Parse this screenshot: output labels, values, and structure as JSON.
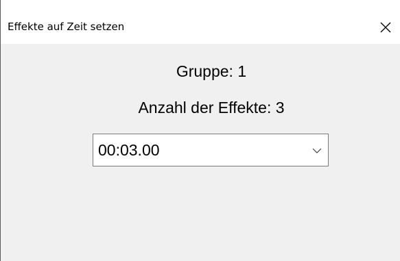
{
  "window": {
    "title": "Effekte auf Zeit setzen",
    "close_icon": "close-icon"
  },
  "content": {
    "group_label": "Gruppe: 1",
    "effect_count_label": "Anzahl der Effekte: 3",
    "time_select": {
      "value": "00:03.00",
      "arrow_icon": "chevron-down-icon"
    }
  }
}
